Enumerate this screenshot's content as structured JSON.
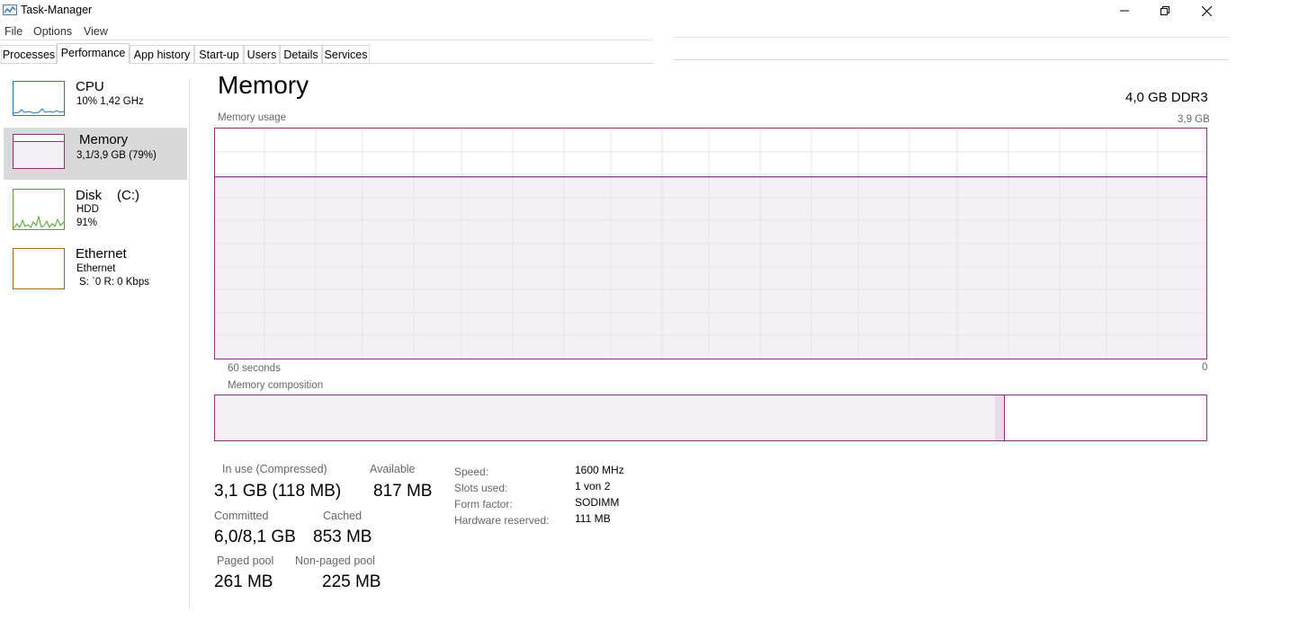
{
  "window": {
    "title": "Task-Manager",
    "buttons": {
      "minimize": "minimize-icon",
      "maximize": "restore-icon",
      "close": "close-icon"
    }
  },
  "menu": [
    "File",
    "Options",
    "View"
  ],
  "tabs": [
    "Processes",
    "Performance",
    "App history",
    "Start-up",
    "Users",
    "Details",
    "Services"
  ],
  "active_tab": "Performance",
  "sidebar": {
    "items": [
      {
        "title": "CPU",
        "line1": "10%  1,42 GHz",
        "line2": "",
        "color": "#1a7db5"
      },
      {
        "title": "Memory",
        "line1": "3,1/3,9 GB (79%)",
        "line2": "",
        "color": "#8b2f8b"
      },
      {
        "title": "Disk",
        "drive": "(C:)",
        "line1": "HDD",
        "line2": "91%",
        "color": "#4da72e"
      },
      {
        "title": "Ethernet",
        "line1": "Ethernet",
        "line2": "S: ˋ0  R: 0 Kbps",
        "color": "#a86a1c"
      }
    ]
  },
  "main": {
    "title": "Memory",
    "hardware": "4,0 GB DDR3",
    "usage_caption": "Memory usage",
    "usage_max": "3,9 GB",
    "x_left": "60 seconds",
    "x_right": "0",
    "usage_percent": 79,
    "composition_caption": "Memory composition",
    "composition": {
      "in_use_fraction": 0.787,
      "modified_fraction": 0.009
    }
  },
  "stats": {
    "in_use_label": "In use (Compressed)",
    "in_use_value": "3,1 GB (118 MB)",
    "available_label": "Available",
    "available_value": "817 MB",
    "committed_label": "Committed",
    "committed_value": "6,0/8,1 GB",
    "cached_label": "Cached",
    "cached_value": "853 MB",
    "paged_label": "Paged pool",
    "paged_value": "261 MB",
    "nonpaged_label": "Non-paged pool",
    "nonpaged_value": "225 MB"
  },
  "details": {
    "speed_label": "Speed:",
    "speed_value": "1600 MHz",
    "slots_label": "Slots used:",
    "slots_value": "1 von 2",
    "form_label": "Form factor:",
    "form_value": "SODIMM",
    "reserved_label": "Hardware reserved:",
    "reserved_value": "111 MB"
  },
  "colors": {
    "accent": "#8b2f8b",
    "fill": "#f4f0f5",
    "grid": "#e6e6e6"
  }
}
